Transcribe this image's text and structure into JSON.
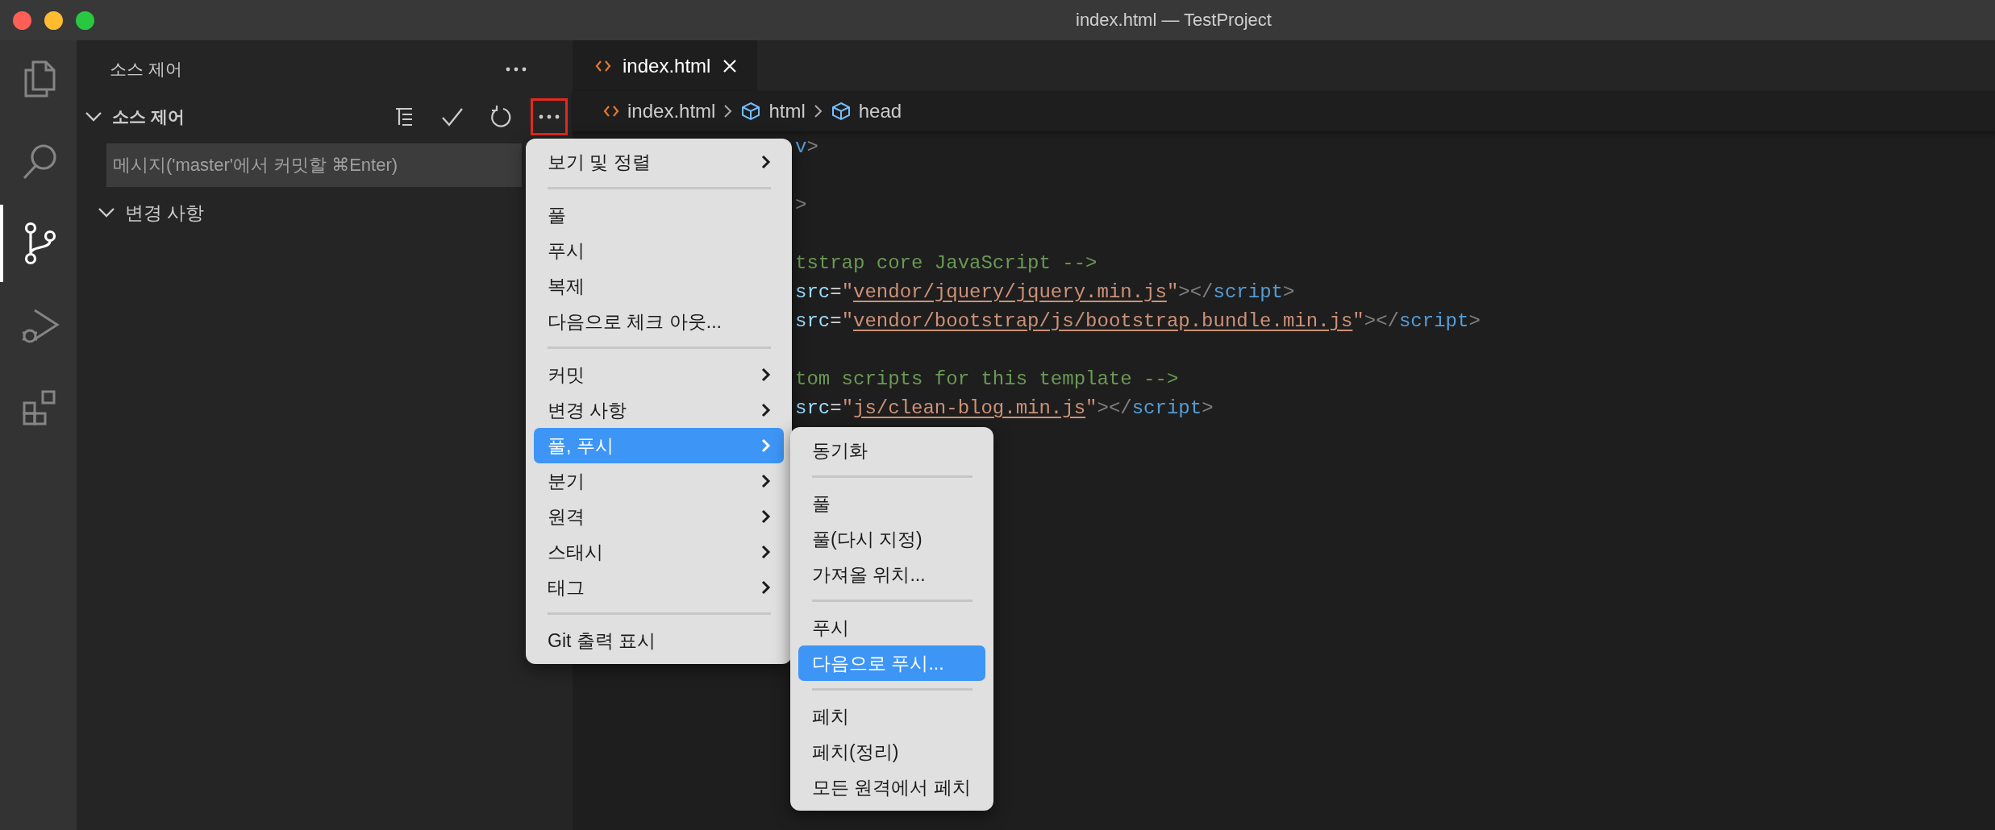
{
  "window": {
    "title": "index.html — TestProject"
  },
  "activity_bar": [
    {
      "kind": "files",
      "selected": false
    },
    {
      "kind": "search",
      "selected": false
    },
    {
      "kind": "scm",
      "selected": true
    },
    {
      "kind": "debug",
      "selected": false
    },
    {
      "kind": "extensions",
      "selected": false
    }
  ],
  "sidebar": {
    "title": "소스 제어",
    "section": {
      "title": "소스 제어",
      "expanded": true,
      "actions": [
        {
          "kind": "tree",
          "highlighted": false
        },
        {
          "kind": "commit",
          "highlighted": false
        },
        {
          "kind": "refresh",
          "highlighted": false
        },
        {
          "kind": "more",
          "highlighted": true
        }
      ]
    },
    "commit_field": {
      "placeholder": "메시지('master'에서 커밋할 ⌘Enter)"
    },
    "groups": [
      {
        "label": "변경 사항",
        "expanded": true
      }
    ]
  },
  "tabs": [
    {
      "label": "index.html",
      "selected": true
    }
  ],
  "breadcrumbs": [
    {
      "label": "index.html",
      "kind": "file"
    },
    {
      "label": "html",
      "kind": "symbol"
    },
    {
      "label": "head",
      "kind": "symbol"
    }
  ],
  "code_lines": [
    {
      "kind": "code",
      "segments": [
        {
          "t": "v",
          "kind": "tag"
        },
        {
          "t": ">",
          "kind": "punct"
        }
      ]
    },
    {
      "kind": "blank"
    },
    {
      "kind": "code",
      "segments": [
        {
          "t": ">",
          "kind": "punct"
        }
      ]
    },
    {
      "kind": "blank"
    },
    {
      "kind": "code",
      "segments": [
        {
          "t": "tstrap core JavaScript -->",
          "kind": "comment"
        }
      ]
    },
    {
      "kind": "code",
      "segments": [
        {
          "t": "src",
          "kind": "attr"
        },
        {
          "t": "=",
          "kind": "plain"
        },
        {
          "t": "\"",
          "kind": "string"
        },
        {
          "t": "vendor/jquery/jquery.min.js",
          "kind": "link"
        },
        {
          "t": "\"",
          "kind": "string"
        },
        {
          "t": "></",
          "kind": "punct"
        },
        {
          "t": "script",
          "kind": "tag"
        },
        {
          "t": ">",
          "kind": "punct"
        }
      ]
    },
    {
      "kind": "code",
      "segments": [
        {
          "t": "src",
          "kind": "attr"
        },
        {
          "t": "=",
          "kind": "plain"
        },
        {
          "t": "\"",
          "kind": "string"
        },
        {
          "t": "vendor/bootstrap/js/bootstrap.bundle.min.js",
          "kind": "link"
        },
        {
          "t": "\"",
          "kind": "string"
        },
        {
          "t": "></",
          "kind": "punct"
        },
        {
          "t": "script",
          "kind": "tag"
        },
        {
          "t": ">",
          "kind": "punct"
        }
      ]
    },
    {
      "kind": "blank"
    },
    {
      "kind": "code",
      "segments": [
        {
          "t": "tom scripts for this template -->",
          "kind": "comment"
        }
      ]
    },
    {
      "kind": "code",
      "segments": [
        {
          "t": "src",
          "kind": "attr"
        },
        {
          "t": "=",
          "kind": "plain"
        },
        {
          "t": "\"",
          "kind": "string"
        },
        {
          "t": "js/clean-blog.min.js",
          "kind": "link"
        },
        {
          "t": "\"",
          "kind": "string"
        },
        {
          "t": "></",
          "kind": "punct"
        },
        {
          "t": "script",
          "kind": "tag"
        },
        {
          "t": ">",
          "kind": "punct"
        }
      ]
    }
  ],
  "context_menu": {
    "items": [
      {
        "kind": "item",
        "label": "보기 및 정렬",
        "has_submenu": true,
        "selected": false
      },
      {
        "kind": "separator"
      },
      {
        "kind": "item",
        "label": "풀",
        "has_submenu": false,
        "selected": false
      },
      {
        "kind": "item",
        "label": "푸시",
        "has_submenu": false,
        "selected": false
      },
      {
        "kind": "item",
        "label": "복제",
        "has_submenu": false,
        "selected": false
      },
      {
        "kind": "item",
        "label": "다음으로 체크 아웃...",
        "has_submenu": false,
        "selected": false
      },
      {
        "kind": "separator"
      },
      {
        "kind": "item",
        "label": "커밋",
        "has_submenu": true,
        "selected": false
      },
      {
        "kind": "item",
        "label": "변경 사항",
        "has_submenu": true,
        "selected": false
      },
      {
        "kind": "item",
        "label": "풀, 푸시",
        "has_submenu": true,
        "selected": true
      },
      {
        "kind": "item",
        "label": "분기",
        "has_submenu": true,
        "selected": false
      },
      {
        "kind": "item",
        "label": "원격",
        "has_submenu": true,
        "selected": false
      },
      {
        "kind": "item",
        "label": "스태시",
        "has_submenu": true,
        "selected": false
      },
      {
        "kind": "item",
        "label": "태그",
        "has_submenu": true,
        "selected": false
      },
      {
        "kind": "separator"
      },
      {
        "kind": "item",
        "label": "Git 출력 표시",
        "has_submenu": false,
        "selected": false
      }
    ]
  },
  "submenu": {
    "items": [
      {
        "kind": "item",
        "label": "동기화",
        "selected": false
      },
      {
        "kind": "separator"
      },
      {
        "kind": "item",
        "label": "풀",
        "selected": false
      },
      {
        "kind": "item",
        "label": "풀(다시 지정)",
        "selected": false
      },
      {
        "kind": "item",
        "label": "가져올 위치...",
        "selected": false
      },
      {
        "kind": "separator"
      },
      {
        "kind": "item",
        "label": "푸시",
        "selected": false
      },
      {
        "kind": "item",
        "label": "다음으로 푸시...",
        "selected": true
      },
      {
        "kind": "separator"
      },
      {
        "kind": "item",
        "label": "페치",
        "selected": false
      },
      {
        "kind": "item",
        "label": "페치(정리)",
        "selected": false
      },
      {
        "kind": "item",
        "label": "모든 원격에서 페치",
        "selected": false
      }
    ]
  }
}
